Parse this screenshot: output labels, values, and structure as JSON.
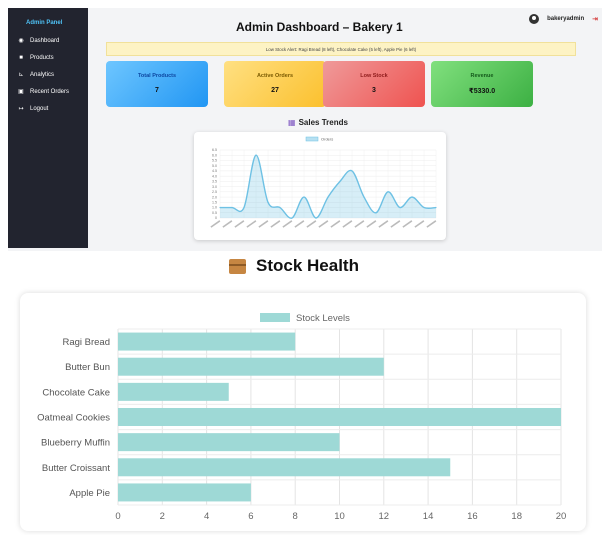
{
  "sidebar": {
    "title": "Admin Panel",
    "items": [
      {
        "label": "Dashboard",
        "icon": "dashboard-icon"
      },
      {
        "label": "Products",
        "icon": "box-icon"
      },
      {
        "label": "Analytics",
        "icon": "chart-icon"
      },
      {
        "label": "Recent Orders",
        "icon": "cart-icon"
      },
      {
        "label": "Logout",
        "icon": "logout-icon"
      }
    ]
  },
  "header": {
    "title": "Admin Dashboard – Bakery 1",
    "username": "bakeryadmin"
  },
  "alert": {
    "text": "Low Stock Alert: Ragi Bread (8 left), Chocolate Cake (5 left), Apple Pie (6 left)"
  },
  "cards": [
    {
      "title": "Total Products",
      "value": "7",
      "color": "#2196f3"
    },
    {
      "title": "Active Orders",
      "value": "27",
      "color": "#fbc02d"
    },
    {
      "title": "Low Stock",
      "value": "3",
      "color": "#ef5350"
    },
    {
      "title": "Revenue",
      "value": "₹5330.0",
      "color": "#3cb043"
    }
  ],
  "sales": {
    "title": "Sales Trends"
  },
  "stock": {
    "title": "Stock Health"
  },
  "chart_data": [
    {
      "type": "line",
      "title": "",
      "series": [
        {
          "name": "Orders",
          "color": "#6ec1e4"
        }
      ],
      "ylim": [
        0,
        6.5
      ],
      "yticks": [
        0,
        0.5,
        1,
        1.5,
        2,
        2.5,
        3,
        3.5,
        4,
        4.5,
        5,
        5.5,
        6,
        6.5
      ],
      "y_tick_labels": [
        "0",
        "0.5",
        "1.0",
        "1.5",
        "2.0",
        "2.5",
        "3.0",
        "3.5",
        "4.0",
        "4.5",
        "5.0",
        "5.5",
        "6.0",
        "6.5"
      ],
      "values": [
        1,
        1,
        1,
        6,
        1.5,
        1,
        0,
        2,
        0,
        2,
        3.5,
        4.5,
        2,
        0.5,
        2.5,
        1,
        2,
        1,
        1
      ],
      "grid": true,
      "legend": "top"
    },
    {
      "type": "bar",
      "orientation": "horizontal",
      "categories": [
        "Ragi Bread",
        "Butter Bun",
        "Chocolate Cake",
        "Oatmeal Cookies",
        "Blueberry Muffin",
        "Butter Croissant",
        "Apple Pie"
      ],
      "series": [
        {
          "name": "Stock Levels",
          "values": [
            8,
            12,
            5,
            20,
            10,
            15,
            6
          ],
          "color": "#9ed9d6"
        }
      ],
      "xlim": [
        0,
        20
      ],
      "xticks": [
        0,
        2,
        4,
        6,
        8,
        10,
        12,
        14,
        16,
        18,
        20
      ],
      "grid": true,
      "legend": "top"
    }
  ]
}
